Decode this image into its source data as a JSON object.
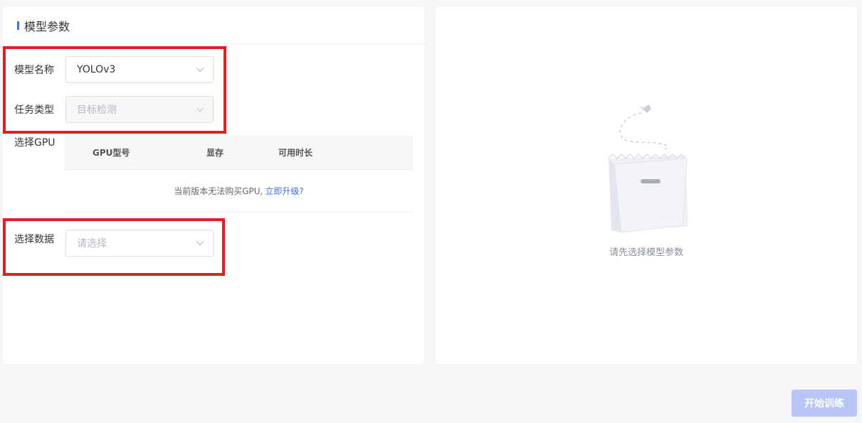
{
  "left_panel": {
    "section_title": "模型参数",
    "model_name": {
      "label": "模型名称",
      "value": "YOLOv3"
    },
    "task_type": {
      "label": "任务类型",
      "value": "目标检测"
    },
    "gpu": {
      "label": "选择GPU",
      "columns": [
        "GPU型号",
        "显存",
        "可用时长"
      ],
      "notice": "当前版本无法购买GPU,",
      "upgrade_link": "立即升级?"
    },
    "dataset": {
      "label": "选择数据",
      "placeholder": "请选择"
    }
  },
  "right_panel": {
    "empty_text": "请先选择模型参数"
  },
  "footer": {
    "start_training_label": "开始训练"
  },
  "colors": {
    "accent": "#3f6fe8",
    "highlight": "#e02020",
    "disabled_button": "#b9c5f7"
  }
}
